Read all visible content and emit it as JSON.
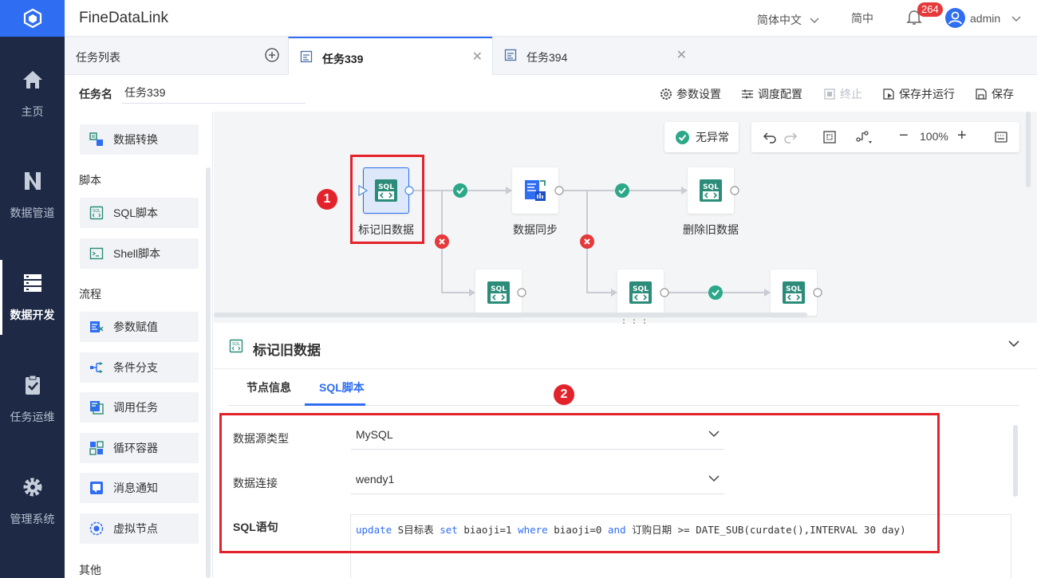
{
  "app": {
    "brand": "FineDataLink"
  },
  "header": {
    "language": "简体中文",
    "simplified": "简中",
    "notification_count": "264",
    "user": "admin"
  },
  "leftnav": {
    "items": [
      {
        "label": "主页",
        "icon": "home-icon"
      },
      {
        "label": "数据管道",
        "icon": "pipeline-icon"
      },
      {
        "label": "数据开发",
        "icon": "dev-icon",
        "active": true
      },
      {
        "label": "任务运维",
        "icon": "clipboard-icon"
      },
      {
        "label": "管理系统",
        "icon": "gear-icon"
      }
    ]
  },
  "tabs": {
    "list_label": "任务列表",
    "items": [
      {
        "label": "任务339",
        "active": true
      },
      {
        "label": "任务394"
      }
    ]
  },
  "taskname": {
    "label": "任务名",
    "value": "任务339"
  },
  "toolbar": {
    "params": "参数设置",
    "schedule": "调度配置",
    "stop": "终止",
    "save_run": "保存并运行",
    "save": "保存"
  },
  "palette": {
    "top_card": "数据转换",
    "section_script": "脚本",
    "sql_script": "SQL脚本",
    "shell_script": "Shell脚本",
    "section_flow": "流程",
    "param_assign": "参数赋值",
    "condition": "条件分支",
    "call_task": "调用任务",
    "loop": "循环容器",
    "message": "消息通知",
    "virtual": "虚拟节点",
    "section_other": "其他"
  },
  "canvas": {
    "status": "无异常",
    "zoom": "100%",
    "nodes": [
      {
        "label": "标记旧数据",
        "type": "sql"
      },
      {
        "label": "数据同步",
        "type": "sync"
      },
      {
        "label": "删除旧数据",
        "type": "sql"
      }
    ],
    "callouts": [
      "1",
      "2"
    ]
  },
  "detail": {
    "title": "标记旧数据",
    "tabs": [
      "节点信息",
      "SQL脚本"
    ],
    "active_tab": "SQL脚本",
    "fields": {
      "datasource_type_label": "数据源类型",
      "datasource_type_value": "MySQL",
      "connection_label": "数据连接",
      "connection_value": "wendy1",
      "sql_label": "SQL语句"
    },
    "sql": {
      "update": "update",
      "table": " S目标表 ",
      "set": "set",
      "assign": " biaoji=1 ",
      "where": "where",
      "cond": " biaoji=0 ",
      "and": "and",
      "rest": " 订购日期 >= DATE_SUB(curdate(),INTERVAL ",
      "n": "30",
      "tail": " day)"
    }
  },
  "colors": {
    "accent": "#2f6df2",
    "nav_bg": "#1e2a45",
    "success": "#2ca889",
    "error": "#e5393b",
    "node_icon": "#2b8c7a"
  }
}
